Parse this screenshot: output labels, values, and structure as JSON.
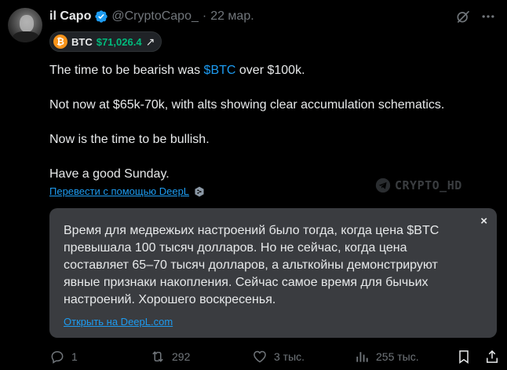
{
  "author": {
    "name": "il Capo",
    "handle": "@CryptoCapo_",
    "separator": "·",
    "date": "22 мар."
  },
  "icons": {
    "verified": "verified-badge-icon",
    "grok": "grok-icon",
    "more": "more-icon",
    "btc": "bitcoin-coin-icon",
    "arrow": "arrow-up-right-icon",
    "deepl": "deepl-icon",
    "close": "close-icon",
    "reply": "reply-icon",
    "retweet": "retweet-icon",
    "like": "heart-icon",
    "views": "views-chart-icon",
    "bookmark": "bookmark-icon",
    "share": "share-icon",
    "telegram": "telegram-icon"
  },
  "cashtag_card": {
    "coin_symbol": "₿",
    "ticker": "BTC",
    "price": "$71,026.4",
    "arrow": "↗"
  },
  "tweet": {
    "line1_pre": "The time to be bearish was ",
    "line1_cashtag": "$BTC",
    "line1_post": " over $100k.",
    "line2": "Not now at $65k-70k, with alts showing clear accumulation schematics.",
    "line3": "Now is the time to be bullish.",
    "line4": "Have a good Sunday."
  },
  "translate": {
    "link": "Перевести с помощью DeepL"
  },
  "watermark": {
    "text": "CRYPTO_HD"
  },
  "translation": {
    "text": "Время для медвежьих настроений было тогда, когда цена $BTC превышала 100 тысяч долларов.  Но не сейчас, когда цена составляет 65–70 тысяч долларов, а альткойны демонстрируют явные признаки накопления.  Сейчас самое время для бычьих настроений.  Хорошего воскресенья.",
    "close": "×",
    "open_link": "Открыть на DeepL.com"
  },
  "stats": {
    "replies": "1",
    "retweets": "292",
    "likes": "3 тыс.",
    "views": "255 тыс."
  },
  "colors": {
    "background": "#000000",
    "text": "#e7e9ea",
    "muted": "#71767b",
    "link": "#1d9bf0",
    "price_up": "#00ba7c",
    "btc_orange": "#f7931a",
    "verified_blue": "#1d9bf0",
    "translation_bg": "#3a3c40"
  }
}
